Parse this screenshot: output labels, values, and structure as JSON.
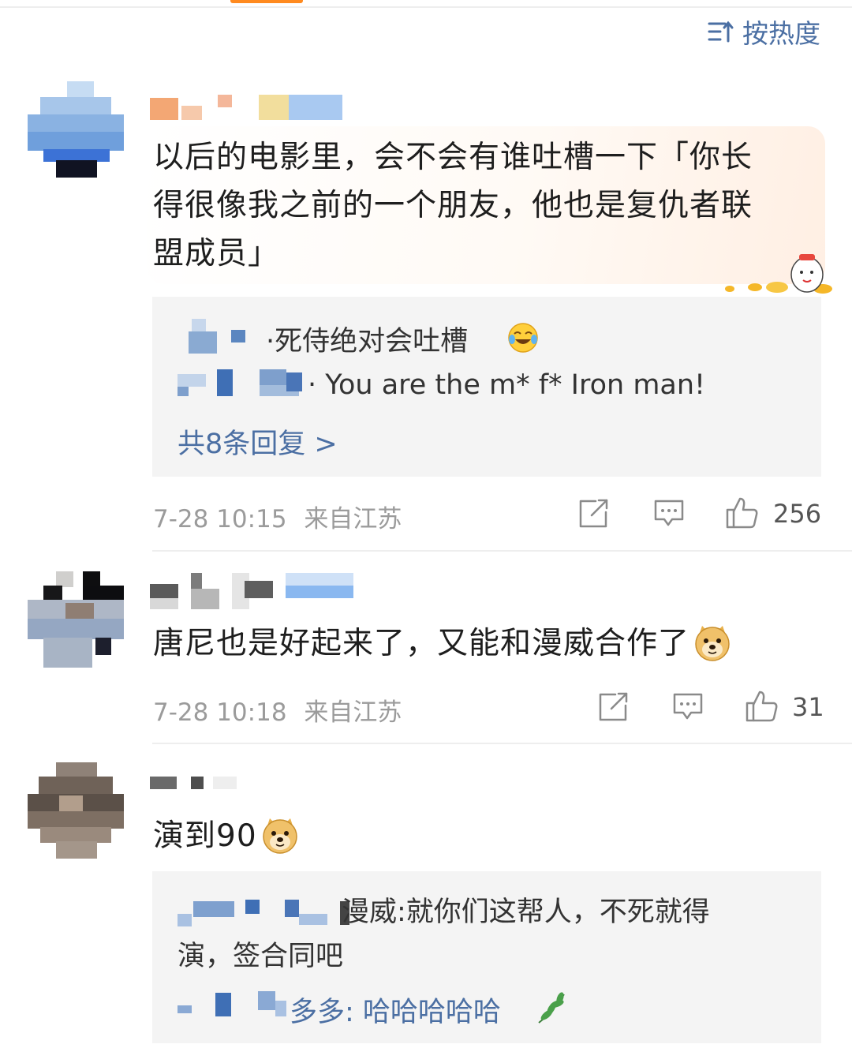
{
  "header": {
    "sort_label": "按热度"
  },
  "comments": [
    {
      "text": "以后的电影里，会不会有谁吐槽一下「你长得很像我之前的一个朋友，他也是复仇者联盟成员」",
      "lines": [
        "以后的电影里，会不会有谁吐槽一下「你长",
        "得很像我之前的一个朋友，他也是复仇者联",
        "盟成员」"
      ],
      "replies": [
        {
          "text": "·死侍绝对会吐槽",
          "emoji": "laugh-cry-emoji"
        },
        {
          "text": "· You are the m* f* Iron man!"
        }
      ],
      "more_replies": "共8条回复 >",
      "time": "7-28 10:15",
      "location": "来自江苏",
      "likes": "256"
    },
    {
      "text": "唐尼也是好起来了，又能和漫威合作了",
      "emoji": "doge-emoji",
      "time": "7-28 10:18",
      "location": "来自江苏",
      "likes": "31"
    },
    {
      "text": "演到90",
      "emoji": "doge-emoji",
      "replies": [
        {
          "lines": [
            "漫威:就你们这帮人，不死就得",
            "演，签合同吧"
          ]
        },
        {
          "text": "多多: 哈哈哈哈哈",
          "emoji": "leaf-emoji"
        }
      ]
    }
  ],
  "colors": {
    "link": "#4b6fa3",
    "meta": "#9b9b9b",
    "accent": "#ff8a1f",
    "reply_bg": "#f4f4f4"
  }
}
